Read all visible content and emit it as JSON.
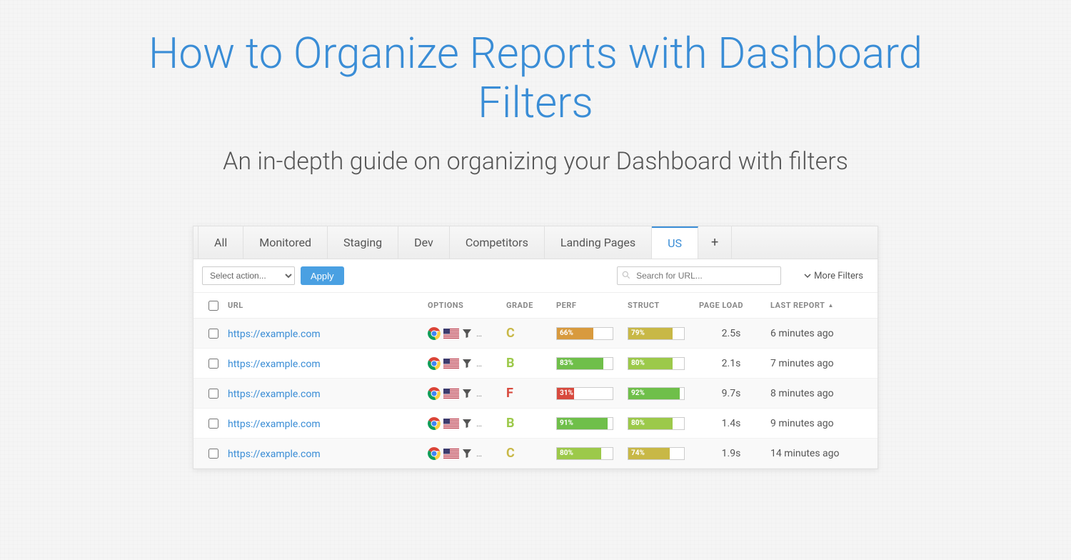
{
  "header": {
    "title": "How to Organize Reports with Dashboard Filters",
    "subtitle": "An in-depth guide on organizing your Dashboard with filters"
  },
  "tabs": {
    "items": [
      "All",
      "Monitored",
      "Staging",
      "Dev",
      "Competitors",
      "Landing Pages",
      "US"
    ],
    "active_index": 6,
    "add_label": "+"
  },
  "toolbar": {
    "select_placeholder": "Select action...",
    "apply_label": "Apply",
    "search_placeholder": "Search for URL...",
    "more_filters_label": "More Filters"
  },
  "table": {
    "columns": {
      "url": "URL",
      "options": "OPTIONS",
      "grade": "GRADE",
      "perf": "PERF",
      "struct": "STRUCT",
      "page_load": "PAGE LOAD",
      "last_report": "LAST REPORT"
    },
    "rows": [
      {
        "url": "https://example.com",
        "grade": "C",
        "perf": 66,
        "perf_color": "orange",
        "struct": 79,
        "struct_color": "yellow",
        "page_load": "2.5s",
        "last_report": "6 minutes ago"
      },
      {
        "url": "https://example.com",
        "grade": "B",
        "perf": 83,
        "perf_color": "green",
        "struct": 80,
        "struct_color": "lime",
        "page_load": "2.1s",
        "last_report": "7 minutes ago"
      },
      {
        "url": "https://example.com",
        "grade": "F",
        "perf": 31,
        "perf_color": "red",
        "struct": 92,
        "struct_color": "green",
        "page_load": "9.7s",
        "last_report": "8 minutes ago"
      },
      {
        "url": "https://example.com",
        "grade": "B",
        "perf": 91,
        "perf_color": "green",
        "struct": 80,
        "struct_color": "lime",
        "page_load": "1.4s",
        "last_report": "9 minutes ago"
      },
      {
        "url": "https://example.com",
        "grade": "C",
        "perf": 80,
        "perf_color": "lime",
        "struct": 74,
        "struct_color": "yellow",
        "page_load": "1.9s",
        "last_report": "14 minutes ago"
      }
    ]
  }
}
